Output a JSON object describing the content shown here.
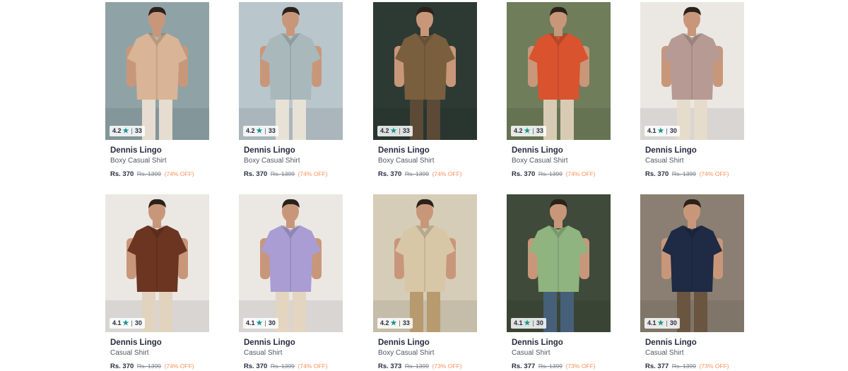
{
  "products": [
    {
      "brand": "Dennis Lingo",
      "name": "Boxy Casual Shirt",
      "rating": "4.2",
      "count": "33",
      "price": "Rs. 370",
      "mrp": "Rs. 1399",
      "discount": "(74% OFF)",
      "bg": "#8fa3a6",
      "shirt": "#d9b496",
      "skin": "#c8977a",
      "pants": "#e6dccf"
    },
    {
      "brand": "Dennis Lingo",
      "name": "Boxy Casual Shirt",
      "rating": "4.2",
      "count": "33",
      "price": "Rs. 370",
      "mrp": "Rs. 1399",
      "discount": "(74% OFF)",
      "bg": "#b9c6cc",
      "shirt": "#a9b9bb",
      "skin": "#c8977a",
      "pants": "#e8e2d6"
    },
    {
      "brand": "Dennis Lingo",
      "name": "Boxy Casual Shirt",
      "rating": "4.2",
      "count": "33",
      "price": "Rs. 370",
      "mrp": "Rs. 1399",
      "discount": "(74% OFF)",
      "bg": "#2d3a34",
      "shirt": "#7a5f3e",
      "skin": "#c8977a",
      "pants": "#5b4a36"
    },
    {
      "brand": "Dennis Lingo",
      "name": "Boxy Casual Shirt",
      "rating": "4.2",
      "count": "33",
      "price": "Rs. 370",
      "mrp": "Rs. 1399",
      "discount": "(74% OFF)",
      "bg": "#6f7d5a",
      "shirt": "#d9532e",
      "skin": "#c8977a",
      "pants": "#d8cbb4"
    },
    {
      "brand": "Dennis Lingo",
      "name": "Casual Shirt",
      "rating": "4.1",
      "count": "30",
      "price": "Rs. 370",
      "mrp": "Rs. 1399",
      "discount": "(74% OFF)",
      "bg": "#ebe8e4",
      "shirt": "#b69a93",
      "skin": "#c8977a",
      "pants": "#e6dccb"
    },
    {
      "brand": "Dennis Lingo",
      "name": "Casual Shirt",
      "rating": "4.1",
      "count": "30",
      "price": "Rs. 370",
      "mrp": "Rs. 1399",
      "discount": "(74% OFF)",
      "bg": "#ebe8e4",
      "shirt": "#6b3522",
      "skin": "#c8977a",
      "pants": "#e1d3bd"
    },
    {
      "brand": "Dennis Lingo",
      "name": "Casual Shirt",
      "rating": "4.1",
      "count": "30",
      "price": "Rs. 370",
      "mrp": "Rs. 1399",
      "discount": "(74% OFF)",
      "bg": "#ebe8e4",
      "shirt": "#a99dd3",
      "skin": "#c8977a",
      "pants": "#e3d5c0"
    },
    {
      "brand": "Dennis Lingo",
      "name": "Boxy Casual Shirt",
      "rating": "4.2",
      "count": "33",
      "price": "Rs. 373",
      "mrp": "Rs. 1399",
      "discount": "(73% OFF)",
      "bg": "#d6cdb8",
      "shirt": "#d8c7a6",
      "skin": "#c8977a",
      "pants": "#b79a6e"
    },
    {
      "brand": "Dennis Lingo",
      "name": "Casual Shirt",
      "rating": "4.1",
      "count": "30",
      "price": "Rs. 377",
      "mrp": "Rs. 1399",
      "discount": "(73% OFF)",
      "bg": "#3f4a3a",
      "shirt": "#8fb47f",
      "skin": "#c8977a",
      "pants": "#46607a"
    },
    {
      "brand": "Dennis Lingo",
      "name": "Casual Shirt",
      "rating": "4.1",
      "count": "30",
      "price": "Rs. 377",
      "mrp": "Rs. 1399",
      "discount": "(73% OFF)",
      "bg": "#8a7f72",
      "shirt": "#1f2a44",
      "skin": "#c8977a",
      "pants": "#6a5540"
    }
  ]
}
